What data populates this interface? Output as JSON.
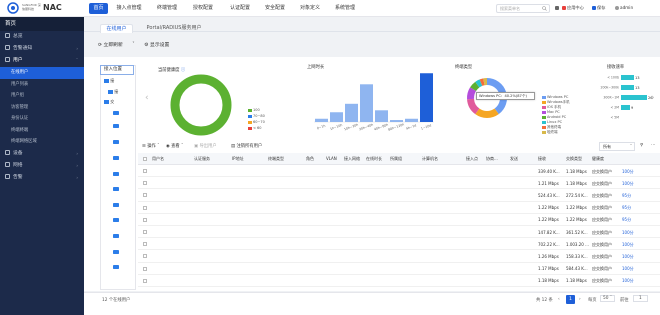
{
  "brand": {
    "logo_text": "SANGFOR\n深信服科技",
    "product": "NAC"
  },
  "topnav": [
    {
      "label": "首页",
      "active": true
    },
    {
      "label": "接入点管理",
      "active": false
    },
    {
      "label": "终端管理",
      "active": false
    },
    {
      "label": "授权配置",
      "active": false
    },
    {
      "label": "认证配置",
      "active": false
    },
    {
      "label": "安全配置",
      "active": false
    },
    {
      "label": "对象定义",
      "active": false
    },
    {
      "label": "系统管理",
      "active": false
    }
  ],
  "search": {
    "placeholder": "搜索菜单名"
  },
  "topbar_tools": [
    "应用中心",
    "保存",
    "admin"
  ],
  "sidebar": {
    "title": "首页",
    "items": [
      {
        "label": "总览",
        "icon": "dashboard-icon"
      },
      {
        "label": "告警通知",
        "icon": "bell-icon",
        "expandable": true
      },
      {
        "label": "用户",
        "icon": "user-icon",
        "expandable": true,
        "expanded": true
      }
    ],
    "sub_items": [
      {
        "label": "在线用户",
        "active": true
      },
      {
        "label": "用户列表",
        "active": false
      },
      {
        "label": "用户组",
        "active": false
      },
      {
        "label": "访客管理",
        "active": false
      },
      {
        "label": "身份认证",
        "active": false
      },
      {
        "label": "终端终端",
        "active": false
      },
      {
        "label": "终端网络区域",
        "active": false
      }
    ],
    "bottom_items": [
      {
        "label": "设备",
        "icon": "device-icon",
        "expandable": true
      },
      {
        "label": "网络",
        "icon": "network-icon",
        "expandable": true
      },
      {
        "label": "告警",
        "icon": "alarm-icon",
        "expandable": true
      }
    ]
  },
  "tabs": [
    {
      "label": "在线用户",
      "active": true
    },
    {
      "label": "Portal/RADIUS服务用户",
      "active": false
    }
  ],
  "toolbar": {
    "refresh": "立即刷新",
    "display_settings": "显示设置"
  },
  "tree": {
    "header": "接入位置",
    "nodes": [
      "接",
      "接",
      "交"
    ]
  },
  "charts": {
    "health": {
      "title": "当前健康度",
      "legend": [
        "100",
        "70~80",
        "60~70",
        "< 60"
      ],
      "colors": [
        "#5cb131",
        "#2b7de9",
        "#f5a623",
        "#e8403b"
      ],
      "values": [
        100,
        0,
        0,
        0
      ]
    },
    "online_time": {
      "title": "上网时长",
      "categories": [
        "0~1h",
        "1h~10h",
        "10h~20h",
        "20h~40h",
        "40h~80h",
        "80h~120h",
        "4h~1d",
        "1~10d"
      ],
      "values": [
        5,
        15,
        28,
        58,
        18,
        3,
        5,
        75
      ]
    },
    "terminal_types": {
      "title": "终端类型",
      "legend": [
        "Windows PC",
        "Windows手机",
        "iOS 手机",
        "Mac PC",
        "Android PC",
        "Linux PC",
        "其他终端",
        "哑终端"
      ],
      "colors": [
        "#6c9df2",
        "#f5a623",
        "#e05a9b",
        "#b44ddc",
        "#5cb131",
        "#2bc3cf",
        "#f56c3a",
        "#d8b94a"
      ],
      "values": [
        40,
        20,
        14,
        10,
        6,
        4,
        3,
        3
      ],
      "tooltip": "Windows PC：40.2%(87个)"
    },
    "upload": {
      "title": "接收速率",
      "categories": [
        "< 100b",
        "200k~300k",
        "300K~1M",
        "< 2M",
        "< 5M"
      ],
      "values": [
        13,
        13,
        26,
        9,
        0
      ]
    }
  },
  "table_toolbar": {
    "ops": "操作",
    "view": "查看",
    "export": "导出用户",
    "reset": "注销所有用户",
    "dropdown": "所有"
  },
  "columns": [
    "用户名",
    "认证服务",
    "IP地址",
    "终端类型",
    "角色",
    "VLAN",
    "接入网络",
    "在线时长",
    "所属组",
    "计算机名",
    "接入点",
    "协商...",
    "发送",
    "接收",
    "交换类型",
    "健康度"
  ],
  "rows": [
    {
      "send": "339.40 K...",
      "recv": "1.18 Mbps",
      "type": "应交换用户",
      "health": "100分"
    },
    {
      "send": "1.21 Mbps",
      "recv": "1.18 Mbps",
      "type": "应交换用户",
      "health": "100分"
    },
    {
      "send": "524.43 K...",
      "recv": "272.54 K...",
      "type": "应交换用户",
      "health": "95分"
    },
    {
      "send": "1.22 Mbps",
      "recv": "1.22 Mbps",
      "type": "应交换用户",
      "health": "95分"
    },
    {
      "send": "1.22 Mbps",
      "recv": "1.22 Mbps",
      "type": "应交换用户",
      "health": "95分"
    },
    {
      "send": "147.82 K...",
      "recv": "361.52 K...",
      "type": "应交换用户",
      "health": "100分"
    },
    {
      "send": "702.22 K...",
      "recv": "1.003.20 ...",
      "type": "应交换用户",
      "health": "100分"
    },
    {
      "send": "1.26 Mbps",
      "recv": "158.33 K...",
      "type": "应交换用户",
      "health": "100分"
    },
    {
      "send": "1.17 Mbps",
      "recv": "584.43 K...",
      "type": "应交换用户",
      "health": "100分"
    },
    {
      "send": "1.18 Mbps",
      "recv": "1.18 Mbps",
      "type": "应交换用户",
      "health": "100分"
    }
  ],
  "footer": {
    "summary": "12 个在线用户",
    "total": "共 12 条",
    "page": "1",
    "per_page_label": "每页",
    "per_page": "50",
    "goto_label": "前往",
    "goto_page": "1"
  }
}
